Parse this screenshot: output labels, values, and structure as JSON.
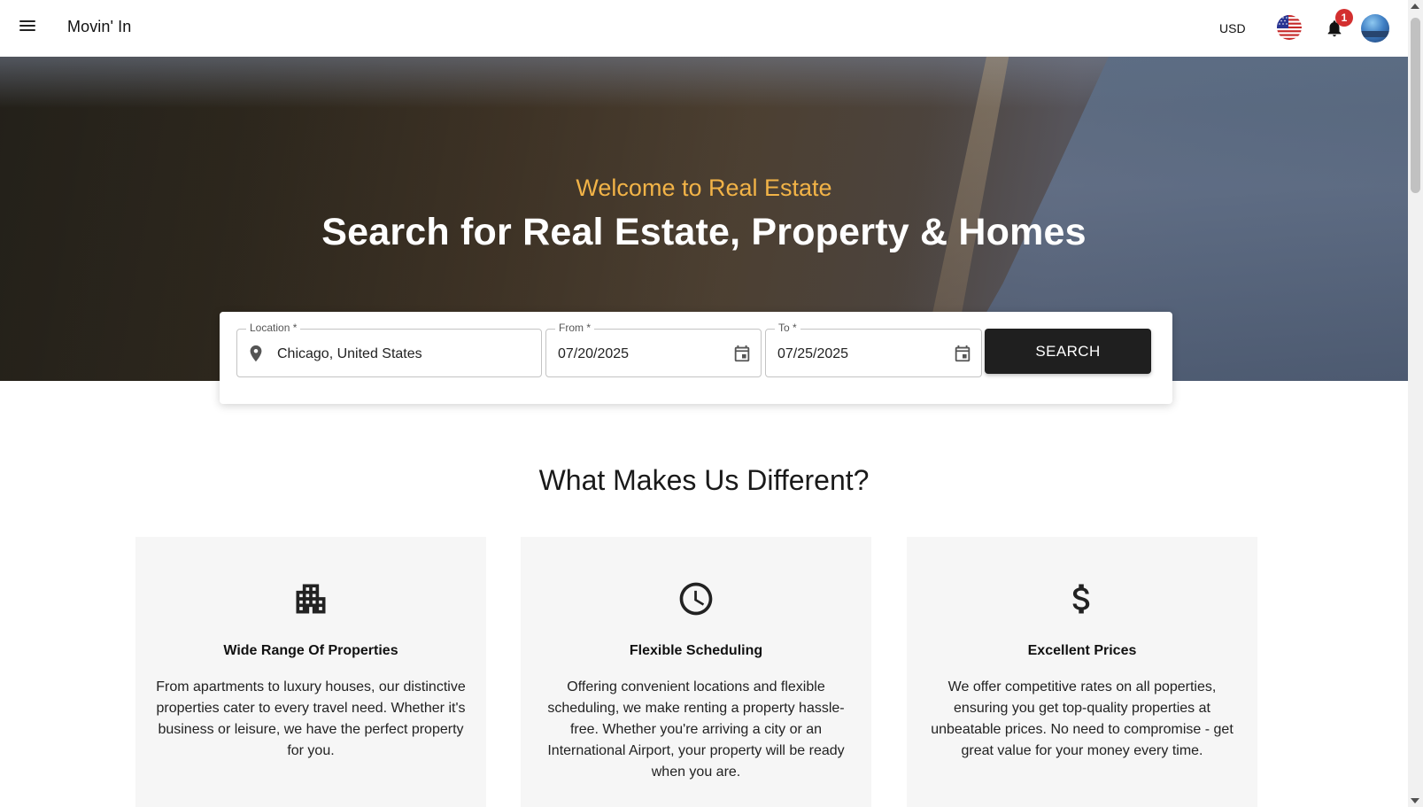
{
  "appbar": {
    "brand": "Movin' In",
    "currency": "USD",
    "notification_count": "1"
  },
  "hero": {
    "subtitle": "Welcome to Real Estate",
    "title": "Search for Real Estate, Property & Homes"
  },
  "search": {
    "location_label": "Location *",
    "location_value": "Chicago, United States",
    "from_label": "From *",
    "from_value": "07/20/2025",
    "to_label": "To *",
    "to_value": "07/25/2025",
    "button_label": "SEARCH"
  },
  "section": {
    "title": "What Makes Us Different?"
  },
  "features": [
    {
      "icon": "building-icon",
      "title": "Wide Range Of Properties",
      "text": "From apartments to luxury houses, our distinctive properties cater to every travel need. Whether it's business or leisure, we have the perfect property for you."
    },
    {
      "icon": "clock-icon",
      "title": "Flexible Scheduling",
      "text": "Offering convenient locations and flexible scheduling, we make renting a property hassle-free. Whether you're arriving a city or an International Airport, your property will be ready when you are."
    },
    {
      "icon": "dollar-icon",
      "title": "Excellent Prices",
      "text": "We offer competitive rates on all poperties, ensuring you get top-quality properties at unbeatable prices. No need to compromise - get great value for your money every time."
    }
  ],
  "colors": {
    "accent": "#f2b347",
    "button": "#1f1f1f",
    "badge": "#d32f2f",
    "card_bg": "#f6f6f6"
  }
}
